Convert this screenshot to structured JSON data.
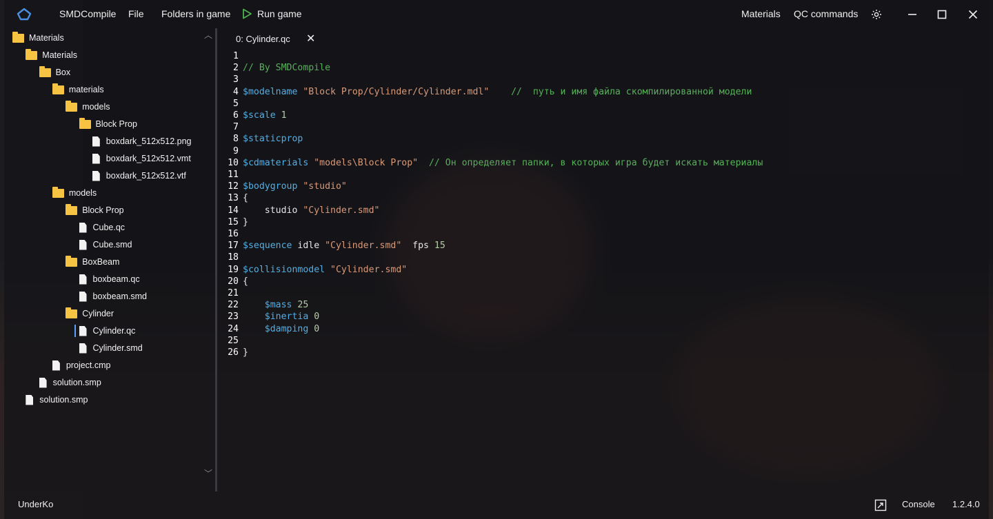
{
  "titlebar": {
    "app_name": "SMDCompile",
    "menu": [
      "File",
      "Folders in game"
    ],
    "run_label": "Run game",
    "right_menu": [
      "Materials",
      "QC commands"
    ],
    "icons": [
      "app-logo-icon",
      "play-icon",
      "gear-icon",
      "minimize-icon",
      "maximize-icon",
      "close-icon"
    ]
  },
  "sidebar": {
    "items": [
      {
        "label": "Materials",
        "type": "folder",
        "depth": 0
      },
      {
        "label": "Materials",
        "type": "folder",
        "depth": 1
      },
      {
        "label": "Box",
        "type": "folder",
        "depth": 2
      },
      {
        "label": "materials",
        "type": "folder",
        "depth": 3
      },
      {
        "label": "models",
        "type": "folder",
        "depth": 4
      },
      {
        "label": "Block Prop",
        "type": "folder",
        "depth": 5
      },
      {
        "label": "boxdark_512x512.png",
        "type": "file",
        "depth": 6
      },
      {
        "label": "boxdark_512x512.vmt",
        "type": "file",
        "depth": 6
      },
      {
        "label": "boxdark_512x512.vtf",
        "type": "file",
        "depth": 6
      },
      {
        "label": "models",
        "type": "folder",
        "depth": 3
      },
      {
        "label": "Block Prop",
        "type": "folder",
        "depth": 4
      },
      {
        "label": "Cube.qc",
        "type": "file",
        "depth": 5
      },
      {
        "label": "Cube.smd",
        "type": "file",
        "depth": 5
      },
      {
        "label": "BoxBeam",
        "type": "folder",
        "depth": 4
      },
      {
        "label": "boxbeam.qc",
        "type": "file",
        "depth": 5
      },
      {
        "label": "boxbeam.smd",
        "type": "file",
        "depth": 5
      },
      {
        "label": "Cylinder",
        "type": "folder",
        "depth": 4
      },
      {
        "label": "Cylinder.qc",
        "type": "file",
        "depth": 5
      },
      {
        "label": "Cylinder.smd",
        "type": "file",
        "depth": 5
      },
      {
        "label": "project.cmp",
        "type": "file",
        "depth": 3
      },
      {
        "label": "solution.smp",
        "type": "file",
        "depth": 2
      },
      {
        "label": "solution.smp",
        "type": "file",
        "depth": 1
      }
    ],
    "selected_index": 17
  },
  "editor": {
    "tab_label": "0: Cylinder.qc",
    "tab_close": "✕",
    "lines": [
      {
        "n": "1",
        "t": []
      },
      {
        "n": "2",
        "t": [
          [
            "cmt",
            "// By SMDCompile"
          ]
        ]
      },
      {
        "n": "3",
        "t": []
      },
      {
        "n": "4",
        "t": [
          [
            "kw",
            "$modelname"
          ],
          [
            "plain",
            " "
          ],
          [
            "str",
            "\"Block Prop/Cylinder/Cylinder.mdl\""
          ],
          [
            "plain",
            "    "
          ],
          [
            "cmt",
            "//  путь и имя файла скомпилированной модели"
          ]
        ]
      },
      {
        "n": "5",
        "t": []
      },
      {
        "n": "6",
        "t": [
          [
            "kw",
            "$scale"
          ],
          [
            "plain",
            " "
          ],
          [
            "num",
            "1"
          ]
        ]
      },
      {
        "n": "7",
        "t": []
      },
      {
        "n": "8",
        "t": [
          [
            "kw",
            "$staticprop"
          ]
        ]
      },
      {
        "n": "9",
        "t": []
      },
      {
        "n": "10",
        "t": [
          [
            "kw",
            "$cdmaterials"
          ],
          [
            "plain",
            " "
          ],
          [
            "str",
            "\"models\\Block Prop\""
          ],
          [
            "plain",
            "  "
          ],
          [
            "cmt",
            "// Он определяет папки, в которых игра будет искать материалы"
          ]
        ]
      },
      {
        "n": "11",
        "t": []
      },
      {
        "n": "12",
        "t": [
          [
            "kw",
            "$bodygroup"
          ],
          [
            "plain",
            " "
          ],
          [
            "str",
            "\"studio\""
          ]
        ]
      },
      {
        "n": "13",
        "t": [
          [
            "plain",
            "{"
          ]
        ]
      },
      {
        "n": "14",
        "t": [
          [
            "plain",
            "    studio "
          ],
          [
            "str",
            "\"Cylinder.smd\""
          ]
        ]
      },
      {
        "n": "15",
        "t": [
          [
            "plain",
            "}"
          ]
        ]
      },
      {
        "n": "16",
        "t": []
      },
      {
        "n": "17",
        "t": [
          [
            "kw",
            "$sequence"
          ],
          [
            "plain",
            " idle "
          ],
          [
            "str",
            "\"Cylinder.smd\""
          ],
          [
            "plain",
            "  fps "
          ],
          [
            "num",
            "15"
          ]
        ]
      },
      {
        "n": "18",
        "t": []
      },
      {
        "n": "19",
        "t": [
          [
            "kw",
            "$collisionmodel"
          ],
          [
            "plain",
            " "
          ],
          [
            "str",
            "\"Cylinder.smd\""
          ]
        ]
      },
      {
        "n": "20",
        "t": [
          [
            "plain",
            "{"
          ]
        ]
      },
      {
        "n": "21",
        "t": []
      },
      {
        "n": "22",
        "t": [
          [
            "plain",
            "    "
          ],
          [
            "kw",
            "$mass"
          ],
          [
            "plain",
            " "
          ],
          [
            "num",
            "25"
          ]
        ]
      },
      {
        "n": "23",
        "t": [
          [
            "plain",
            "    "
          ],
          [
            "kw",
            "$inertia"
          ],
          [
            "plain",
            " "
          ],
          [
            "num",
            "0"
          ]
        ]
      },
      {
        "n": "24",
        "t": [
          [
            "plain",
            "    "
          ],
          [
            "kw",
            "$damping"
          ],
          [
            "plain",
            " "
          ],
          [
            "num",
            "0"
          ]
        ]
      },
      {
        "n": "25",
        "t": []
      },
      {
        "n": "26",
        "t": [
          [
            "plain",
            "}"
          ]
        ]
      }
    ]
  },
  "statusbar": {
    "user": "UnderKo",
    "console_label": "Console",
    "version": "1.2.4.0"
  },
  "colors": {
    "keyword": "#4fb0e8",
    "string": "#d99a7a",
    "number": "#b5cea8",
    "comment": "#57b05a",
    "folder": "#f6c342",
    "accent": "#5aa0ff"
  }
}
